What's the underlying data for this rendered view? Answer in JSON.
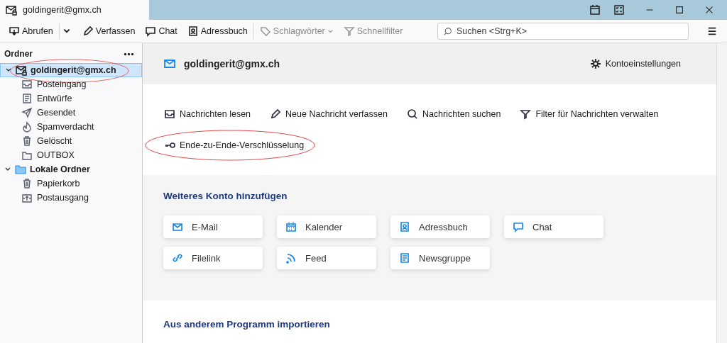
{
  "window": {
    "tab_title": "goldingerit@gmx.ch"
  },
  "toolbar": {
    "buttons": [
      {
        "label": "Abrufen",
        "disabled": false
      },
      {
        "label": "Verfassen",
        "disabled": false
      },
      {
        "label": "Chat",
        "disabled": false
      },
      {
        "label": "Adressbuch",
        "disabled": false
      },
      {
        "label": "Schlagwörter",
        "disabled": true
      },
      {
        "label": "Schnellfilter",
        "disabled": true
      }
    ],
    "search": {
      "placeholder": "Suchen <Strg+K>"
    }
  },
  "folder_pane": {
    "title": "Ordner",
    "tree": [
      {
        "label": "goldingerit@gmx.ch",
        "selected": true,
        "expanded": true,
        "highlighted": true,
        "children": [
          {
            "label": "Posteingang",
            "selected": false
          },
          {
            "label": "Entwürfe",
            "selected": false
          },
          {
            "label": "Gesendet",
            "selected": false
          },
          {
            "label": "Spamverdacht",
            "selected": false
          },
          {
            "label": "Gelöscht",
            "selected": false
          },
          {
            "label": "OUTBOX",
            "selected": false
          }
        ]
      },
      {
        "label": "Lokale Ordner",
        "selected": false,
        "expanded": true,
        "highlighted": false,
        "children": [
          {
            "label": "Papierkorb",
            "selected": false
          },
          {
            "label": "Postausgang",
            "selected": false
          }
        ]
      }
    ]
  },
  "account": {
    "title": "goldingerit@gmx.ch",
    "settings": "Kontoeinstellungen",
    "actions": [
      {
        "label": "Nachrichten lesen",
        "highlighted": false
      },
      {
        "label": "Neue Nachricht verfassen",
        "highlighted": false
      },
      {
        "label": "Nachrichten suchen",
        "highlighted": false
      },
      {
        "label": "Filter für Nachrichten verwalten",
        "highlighted": false
      },
      {
        "label": "Ende-zu-Ende-Verschlüsselung",
        "highlighted": true
      }
    ]
  },
  "add_account": {
    "title": "Weiteres Konto hinzufügen",
    "cards": [
      "E-Mail",
      "Kalender",
      "Adressbuch",
      "Chat",
      "Filelink",
      "Feed",
      "Newsgruppe"
    ]
  },
  "import": {
    "title": "Aus anderem Programm importieren"
  }
}
